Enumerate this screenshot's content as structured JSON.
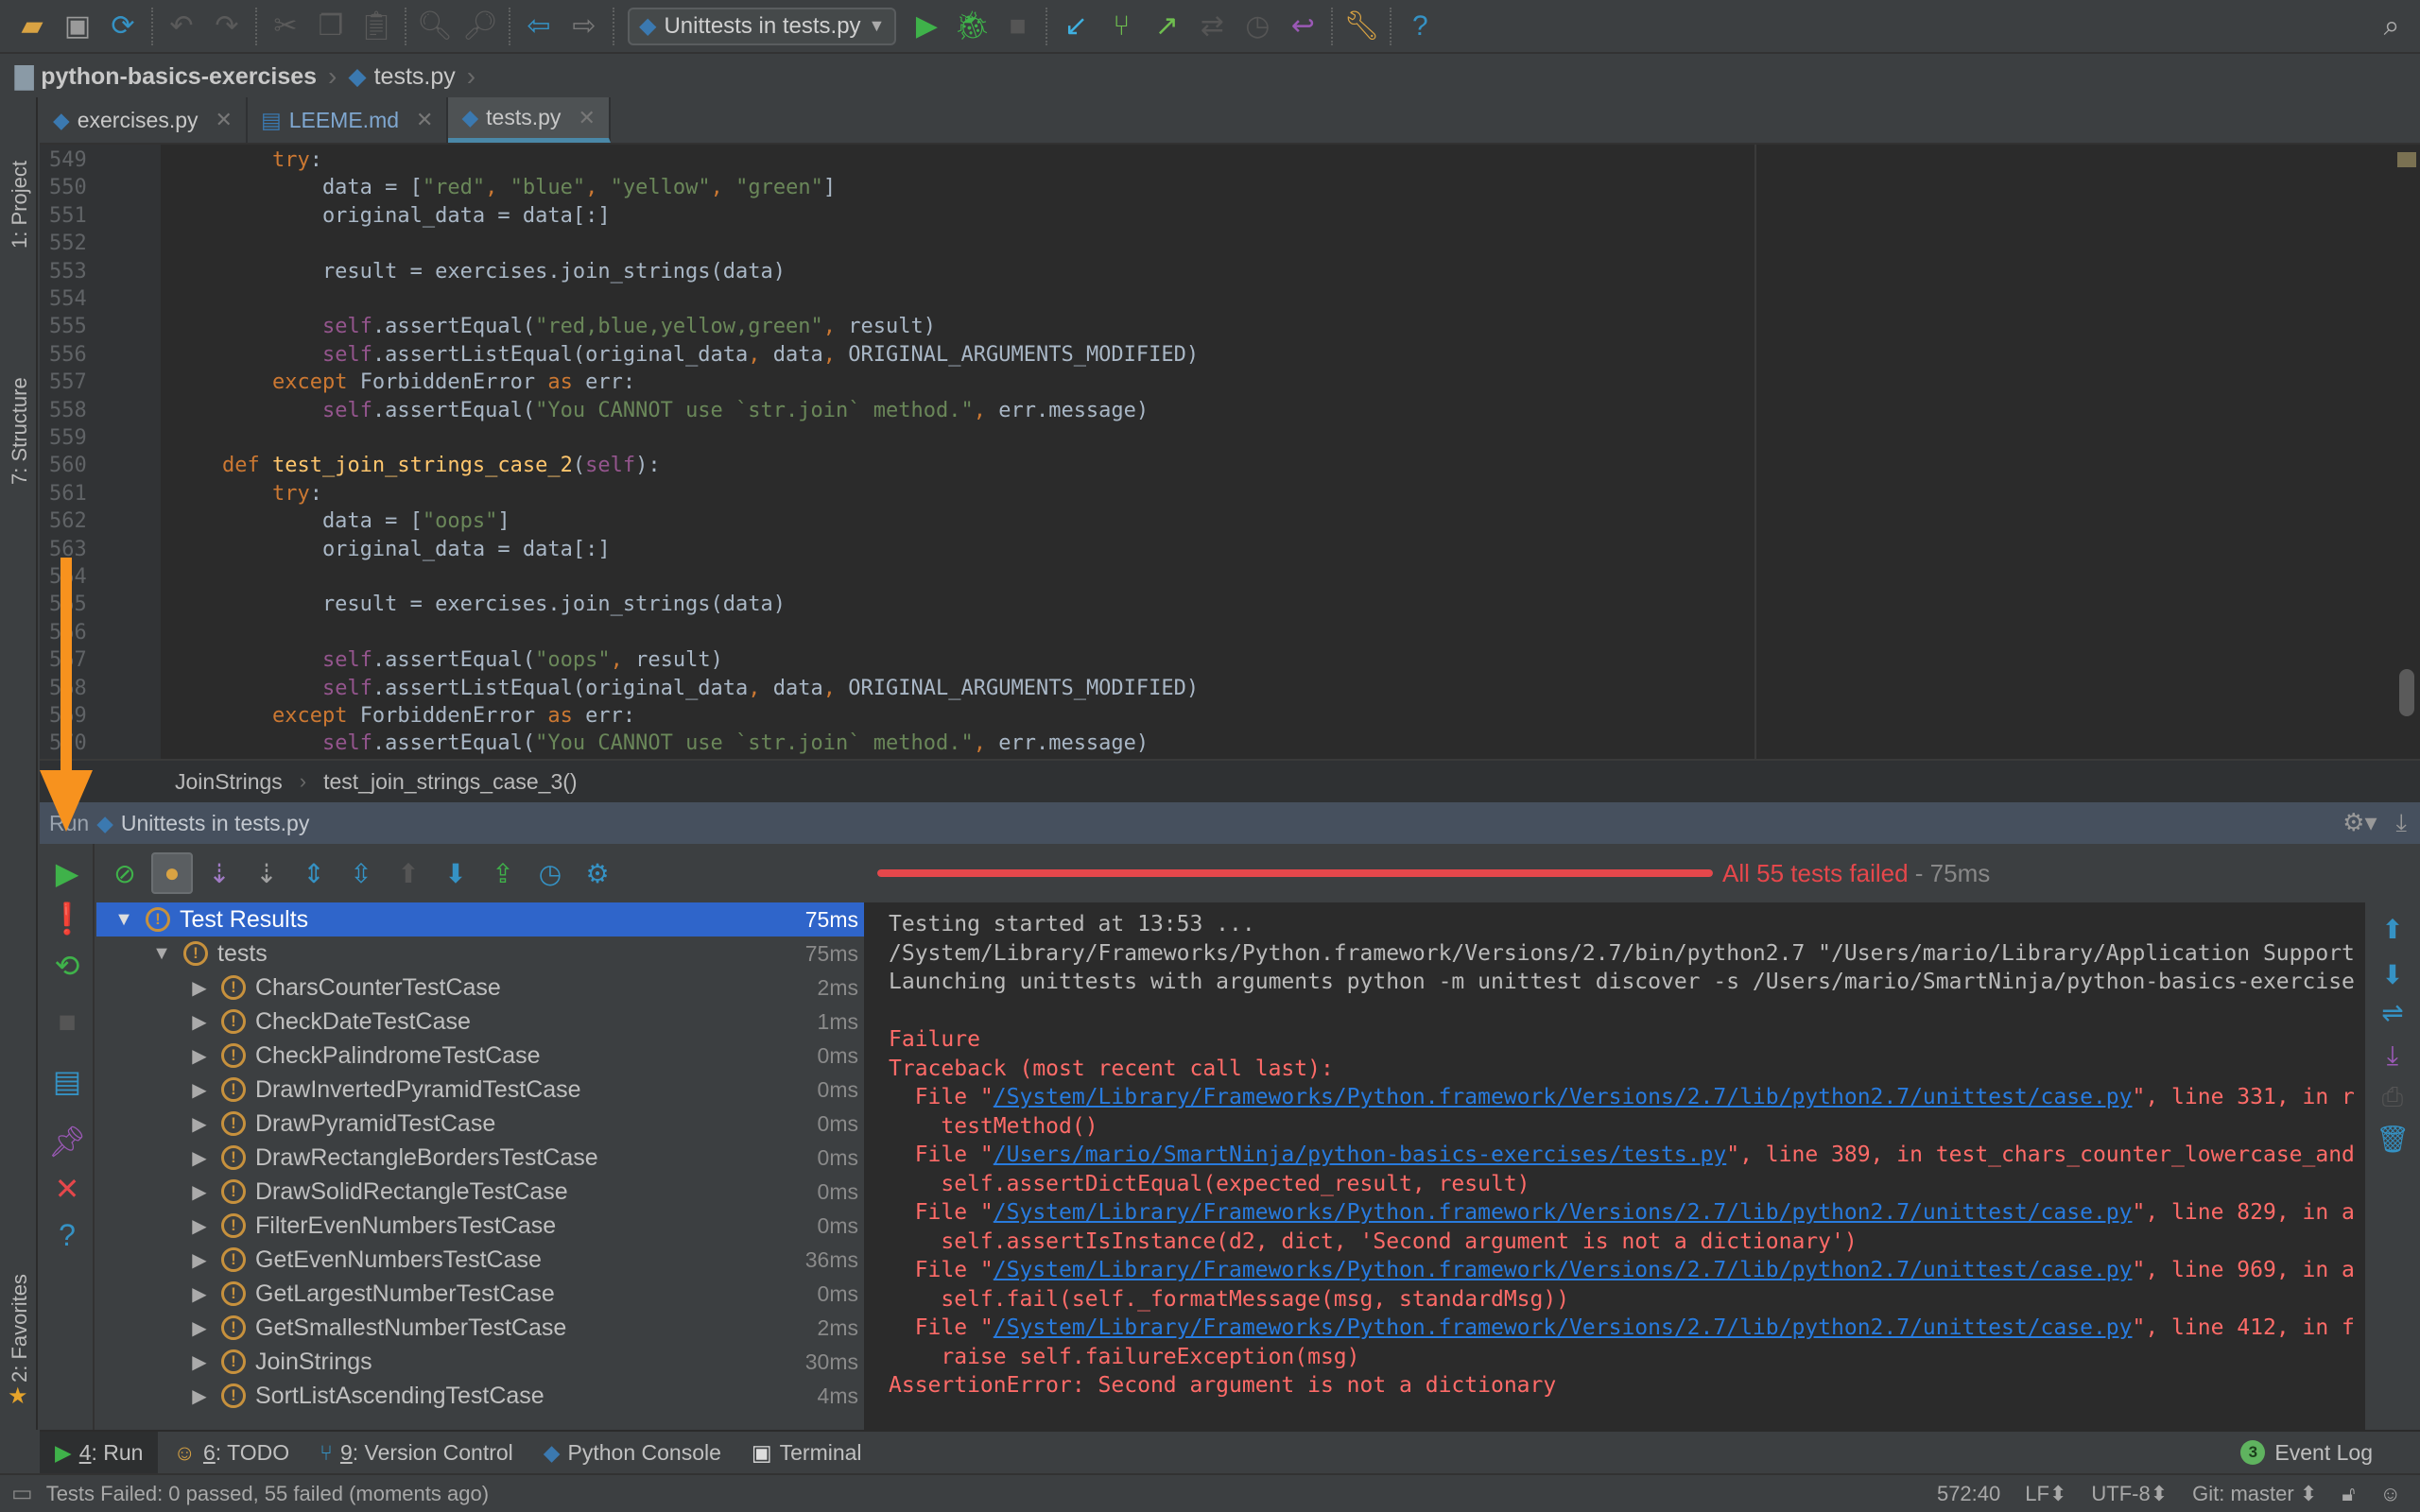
{
  "toolbar": {
    "run_config": "Unittests in tests.py",
    "icons": [
      "open-folder-icon",
      "save-icon",
      "sync-icon",
      "undo-icon",
      "redo-icon",
      "cut-icon",
      "copy-icon",
      "paste-icon",
      "find-icon",
      "replace-icon",
      "back-icon",
      "forward-icon",
      "run-icon",
      "debug-icon",
      "stop-icon",
      "vcs-update-icon",
      "vcs-commit-icon",
      "vcs-push-icon",
      "vcs-compare-icon",
      "vcs-history-icon",
      "vcs-revert-icon",
      "settings-icon",
      "help-icon",
      "search-everywhere-icon"
    ]
  },
  "navbar": {
    "project": "python-basics-exercises",
    "file": "tests.py"
  },
  "left_stripe": {
    "project": "1: Project",
    "structure": "7: Structure",
    "favorites": "2: Favorites"
  },
  "editor_tabs": [
    {
      "label": "exercises.py",
      "icon": "python-file-icon",
      "active": false
    },
    {
      "label": "LEEME.md",
      "icon": "markdown-file-icon",
      "active": false
    },
    {
      "label": "tests.py",
      "icon": "python-file-icon",
      "active": true
    }
  ],
  "editor": {
    "lines": [
      {
        "n": "549",
        "segs": [
          [
            "        ",
            ""
          ],
          [
            "try",
            "kw"
          ],
          [
            ":",
            ""
          ]
        ]
      },
      {
        "n": "550",
        "segs": [
          [
            "            data = [",
            ""
          ],
          [
            "\"red\"",
            "str"
          ],
          [
            ", ",
            "kw"
          ],
          [
            "\"blue\"",
            "str"
          ],
          [
            ", ",
            "kw"
          ],
          [
            "\"yellow\"",
            "str"
          ],
          [
            ", ",
            "kw"
          ],
          [
            "\"green\"",
            "str"
          ],
          [
            "]",
            ""
          ]
        ]
      },
      {
        "n": "551",
        "segs": [
          [
            "            original_data = data[:]",
            ""
          ]
        ]
      },
      {
        "n": "552",
        "segs": []
      },
      {
        "n": "553",
        "segs": [
          [
            "            result = exercises.join_strings(data)",
            ""
          ]
        ]
      },
      {
        "n": "554",
        "segs": []
      },
      {
        "n": "555",
        "segs": [
          [
            "            ",
            ""
          ],
          [
            "self",
            "self"
          ],
          [
            ".assertEqual(",
            ""
          ],
          [
            "\"red,blue,yellow,green\"",
            "str"
          ],
          [
            ", ",
            "kw"
          ],
          [
            "result)",
            ""
          ]
        ]
      },
      {
        "n": "556",
        "segs": [
          [
            "            ",
            ""
          ],
          [
            "self",
            "self"
          ],
          [
            ".assertListEqual(original_data",
            ""
          ],
          [
            ", ",
            "kw"
          ],
          [
            "data",
            ""
          ],
          [
            ", ",
            "kw"
          ],
          [
            "ORIGINAL_ARGUMENTS_MODIFIED)",
            ""
          ]
        ]
      },
      {
        "n": "557",
        "segs": [
          [
            "        ",
            ""
          ],
          [
            "except ",
            "kw"
          ],
          [
            "ForbiddenError ",
            ""
          ],
          [
            "as ",
            "kw"
          ],
          [
            "err:",
            ""
          ]
        ]
      },
      {
        "n": "558",
        "segs": [
          [
            "            ",
            ""
          ],
          [
            "self",
            "self"
          ],
          [
            ".assertEqual(",
            ""
          ],
          [
            "\"You CANNOT use `str.join` method.\"",
            "str"
          ],
          [
            ", ",
            "kw"
          ],
          [
            "err.message)",
            ""
          ]
        ]
      },
      {
        "n": "559",
        "segs": []
      },
      {
        "n": "560",
        "segs": [
          [
            "    ",
            ""
          ],
          [
            "def ",
            "kw"
          ],
          [
            "test_join_strings_case_2",
            "fn"
          ],
          [
            "(",
            ""
          ],
          [
            "self",
            "self"
          ],
          [
            "):",
            ""
          ]
        ]
      },
      {
        "n": "561",
        "segs": [
          [
            "        ",
            ""
          ],
          [
            "try",
            "kw"
          ],
          [
            ":",
            ""
          ]
        ]
      },
      {
        "n": "562",
        "segs": [
          [
            "            data = [",
            ""
          ],
          [
            "\"oops\"",
            "str"
          ],
          [
            "]",
            ""
          ]
        ]
      },
      {
        "n": "563",
        "segs": [
          [
            "            original_data = data[:]",
            ""
          ]
        ]
      },
      {
        "n": "564",
        "segs": []
      },
      {
        "n": "565",
        "segs": [
          [
            "            result = exercises.join_strings(data)",
            ""
          ]
        ]
      },
      {
        "n": "566",
        "segs": []
      },
      {
        "n": "567",
        "segs": [
          [
            "            ",
            ""
          ],
          [
            "self",
            "self"
          ],
          [
            ".assertEqual(",
            ""
          ],
          [
            "\"oops\"",
            "str"
          ],
          [
            ", ",
            "kw"
          ],
          [
            "result)",
            ""
          ]
        ]
      },
      {
        "n": "568",
        "segs": [
          [
            "            ",
            ""
          ],
          [
            "self",
            "self"
          ],
          [
            ".assertListEqual(original_data",
            ""
          ],
          [
            ", ",
            "kw"
          ],
          [
            "data",
            ""
          ],
          [
            ", ",
            "kw"
          ],
          [
            "ORIGINAL_ARGUMENTS_MODIFIED)",
            ""
          ]
        ]
      },
      {
        "n": "569",
        "segs": [
          [
            "        ",
            ""
          ],
          [
            "except ",
            "kw"
          ],
          [
            "ForbiddenError ",
            ""
          ],
          [
            "as ",
            "kw"
          ],
          [
            "err:",
            ""
          ]
        ]
      },
      {
        "n": "570",
        "segs": [
          [
            "            ",
            ""
          ],
          [
            "self",
            "self"
          ],
          [
            ".assertEqual(",
            ""
          ],
          [
            "\"You CANNOT use `str.join` method.\"",
            "str"
          ],
          [
            ", ",
            "kw"
          ],
          [
            "err.message)",
            ""
          ]
        ]
      }
    ]
  },
  "editor_breadcrumb": {
    "class": "JoinStrings",
    "method": "test_join_strings_case_3()"
  },
  "run_panel": {
    "title_prefix": "Run",
    "title": "Unittests in tests.py",
    "progress": {
      "fraction": 1.0,
      "status": "All 55 tests failed",
      "duration": " - 75ms"
    },
    "tree": [
      {
        "label": "Test Results",
        "time": "75ms",
        "level": 0,
        "expanded": true,
        "selected": true
      },
      {
        "label": "tests",
        "time": "75ms",
        "level": 1,
        "expanded": true
      },
      {
        "label": "CharsCounterTestCase",
        "time": "2ms",
        "level": 2
      },
      {
        "label": "CheckDateTestCase",
        "time": "1ms",
        "level": 2
      },
      {
        "label": "CheckPalindromeTestCase",
        "time": "0ms",
        "level": 2
      },
      {
        "label": "DrawInvertedPyramidTestCase",
        "time": "0ms",
        "level": 2
      },
      {
        "label": "DrawPyramidTestCase",
        "time": "0ms",
        "level": 2
      },
      {
        "label": "DrawRectangleBordersTestCase",
        "time": "0ms",
        "level": 2
      },
      {
        "label": "DrawSolidRectangleTestCase",
        "time": "0ms",
        "level": 2
      },
      {
        "label": "FilterEvenNumbersTestCase",
        "time": "0ms",
        "level": 2
      },
      {
        "label": "GetEvenNumbersTestCase",
        "time": "36ms",
        "level": 2
      },
      {
        "label": "GetLargestNumberTestCase",
        "time": "0ms",
        "level": 2
      },
      {
        "label": "GetSmallestNumberTestCase",
        "time": "2ms",
        "level": 2
      },
      {
        "label": "JoinStrings",
        "time": "30ms",
        "level": 2
      },
      {
        "label": "SortListAscendingTestCase",
        "time": "4ms",
        "level": 2
      }
    ],
    "console": [
      {
        "type": "plain",
        "text": "Testing started at 13:53 ..."
      },
      {
        "type": "plain",
        "text": "/System/Library/Frameworks/Python.framework/Versions/2.7/bin/python2.7 \"/Users/mario/Library/Application Support"
      },
      {
        "type": "plain",
        "text": "Launching unittests with arguments python -m unittest discover -s /Users/mario/SmartNinja/python-basics-exercise"
      },
      {
        "type": "blank",
        "text": ""
      },
      {
        "type": "err",
        "text": "Failure"
      },
      {
        "type": "err",
        "text": "Traceback (most recent call last):"
      },
      {
        "type": "file",
        "pre": "  File \"",
        "link": "/System/Library/Frameworks/Python.framework/Versions/2.7/lib/python2.7/unittest/case.py",
        "post": "\", line 331, in r"
      },
      {
        "type": "err",
        "text": "    testMethod()"
      },
      {
        "type": "file",
        "pre": "  File \"",
        "link": "/Users/mario/SmartNinja/python-basics-exercises/tests.py",
        "post": "\", line 389, in test_chars_counter_lowercase_and"
      },
      {
        "type": "err",
        "text": "    self.assertDictEqual(expected_result, result)"
      },
      {
        "type": "file",
        "pre": "  File \"",
        "link": "/System/Library/Frameworks/Python.framework/Versions/2.7/lib/python2.7/unittest/case.py",
        "post": "\", line 829, in a"
      },
      {
        "type": "err",
        "text": "    self.assertIsInstance(d2, dict, 'Second argument is not a dictionary')"
      },
      {
        "type": "file",
        "pre": "  File \"",
        "link": "/System/Library/Frameworks/Python.framework/Versions/2.7/lib/python2.7/unittest/case.py",
        "post": "\", line 969, in a"
      },
      {
        "type": "err",
        "text": "    self.fail(self._formatMessage(msg, standardMsg))"
      },
      {
        "type": "file",
        "pre": "  File \"",
        "link": "/System/Library/Frameworks/Python.framework/Versions/2.7/lib/python2.7/unittest/case.py",
        "post": "\", line 412, in f"
      },
      {
        "type": "err",
        "text": "    raise self.failureException(msg)"
      },
      {
        "type": "err",
        "text": "AssertionError: Second argument is not a dictionary"
      }
    ]
  },
  "tool_tabs": [
    {
      "num": "4",
      "label": ": Run",
      "icon": "run-icon",
      "active": true
    },
    {
      "num": "6",
      "label": ": TODO",
      "icon": "todo-icon"
    },
    {
      "num": "9",
      "label": ": Version Control",
      "icon": "vcs-icon"
    },
    {
      "num": "",
      "label": "Python Console",
      "icon": "python-console-icon"
    },
    {
      "num": "",
      "label": "Terminal",
      "icon": "terminal-icon"
    }
  ],
  "event_log": {
    "count": "3",
    "label": "Event Log"
  },
  "statusbar": {
    "message": "Tests Failed: 0 passed, 55 failed (moments ago)",
    "position": "572:40",
    "line_sep": "LF",
    "encoding": "UTF-8",
    "vcs": "Git: master"
  },
  "colors": {
    "accent_selection": "#2f65ca",
    "fail_red": "#e5474b",
    "warning_orange": "#c7913d",
    "link_blue": "#287bde",
    "annotation_orange": "#f7921e"
  }
}
